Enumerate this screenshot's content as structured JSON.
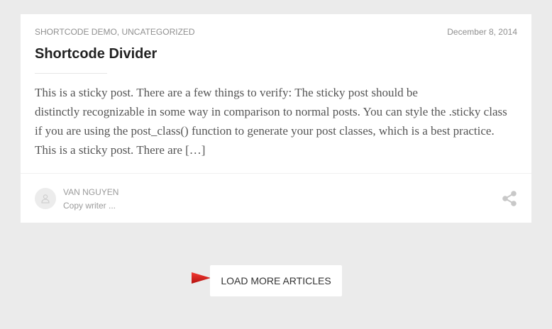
{
  "post": {
    "categories": "SHORTCODE DEMO, UNCATEGORIZED",
    "date": "December 8, 2014",
    "title": "Shortcode Divider",
    "excerpt_lines": [
      "This is a sticky post. There are a few things to verify: The sticky post should be",
      "distinctly recognizable in some way in comparison to normal posts. You can style the .sticky class",
      "if you are using the post_class() function to generate your post classes, which is a best practice.",
      "This is a sticky post. There are […]"
    ]
  },
  "author": {
    "name": "VAN NGUYEN",
    "role": "Copy writer ...",
    "avatar_icon": "user-icon"
  },
  "share": {
    "icon": "share-icon"
  },
  "load_more": {
    "label": "LOAD MORE ARTICLES"
  },
  "annotation": {
    "arrow_icon": "red-arrow-icon",
    "arrow_color": "#e0201b"
  },
  "colors": {
    "background": "#ebebeb",
    "card": "#ffffff",
    "title": "#222222",
    "meta": "#8f8f8f"
  }
}
